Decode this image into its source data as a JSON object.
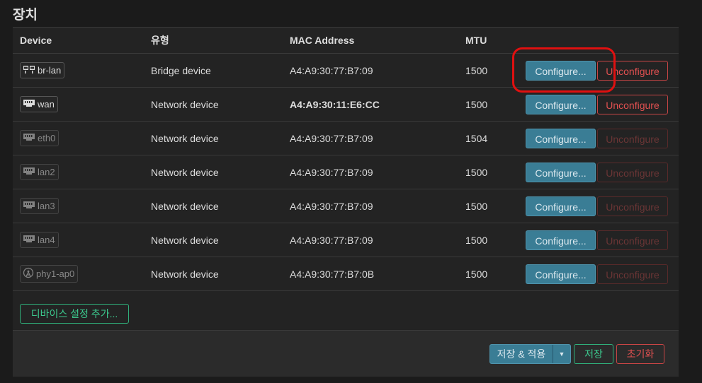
{
  "section": {
    "title": "장치"
  },
  "table": {
    "headers": {
      "device": "Device",
      "type": "유형",
      "mac": "MAC Address",
      "mtu": "MTU"
    },
    "rows": [
      {
        "device": "br-lan",
        "icon": "bridge-icon",
        "type": "Bridge device",
        "mac": "A4:A9:30:77:B7:09",
        "mtu": "1500",
        "configure": "Configure...",
        "unconfigure": "Unconfigure"
      },
      {
        "device": "wan",
        "icon": "ethernet-port-icon",
        "type": "Network device",
        "mac": "A4:A9:30:11:E6:CC",
        "mtu": "1500",
        "configure": "Configure...",
        "unconfigure": "Unconfigure"
      },
      {
        "device": "eth0",
        "icon": "ethernet-port-icon",
        "type": "Network device",
        "mac": "A4:A9:30:77:B7:09",
        "mtu": "1504",
        "configure": "Configure...",
        "unconfigure": "Unconfigure"
      },
      {
        "device": "lan2",
        "icon": "ethernet-port-icon",
        "type": "Network device",
        "mac": "A4:A9:30:77:B7:09",
        "mtu": "1500",
        "configure": "Configure...",
        "unconfigure": "Unconfigure"
      },
      {
        "device": "lan3",
        "icon": "ethernet-port-icon",
        "type": "Network device",
        "mac": "A4:A9:30:77:B7:09",
        "mtu": "1500",
        "configure": "Configure...",
        "unconfigure": "Unconfigure"
      },
      {
        "device": "lan4",
        "icon": "ethernet-port-icon",
        "type": "Network device",
        "mac": "A4:A9:30:77:B7:09",
        "mtu": "1500",
        "configure": "Configure...",
        "unconfigure": "Unconfigure"
      },
      {
        "device": "phy1-ap0",
        "icon": "wireless-icon",
        "type": "Network device",
        "mac": "A4:A9:30:77:B7:0B",
        "mtu": "1500",
        "configure": "Configure...",
        "unconfigure": "Unconfigure"
      }
    ]
  },
  "add_device_label": "디바이스 설정 추가...",
  "footer": {
    "save_apply_label": "저장 & 적용",
    "save_label": "저장",
    "reset_label": "초기화"
  },
  "colors": {
    "accent": "#3a7d95",
    "positive": "#3cc98e",
    "negative": "#e05050",
    "highlight": "#e01010"
  }
}
